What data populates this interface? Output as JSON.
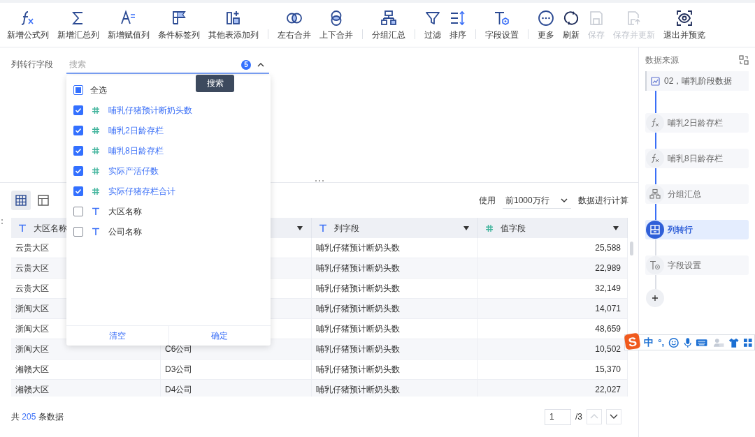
{
  "toolbar": {
    "groups": [
      [
        {
          "label": "新增公式列",
          "disabled": false
        },
        {
          "label": "新增汇总列",
          "disabled": false
        },
        {
          "label": "新增赋值列",
          "disabled": false
        },
        {
          "label": "条件标签列",
          "disabled": false
        },
        {
          "label": "其他表添加列",
          "disabled": false
        }
      ],
      [
        {
          "label": "左右合并",
          "disabled": false
        },
        {
          "label": "上下合并",
          "disabled": false
        }
      ],
      [
        {
          "label": "分组汇总",
          "disabled": false
        }
      ],
      [
        {
          "label": "过滤",
          "disabled": false
        },
        {
          "label": "排序",
          "disabled": false
        }
      ],
      [
        {
          "label": "字段设置",
          "disabled": false
        }
      ],
      [
        {
          "label": "更多",
          "disabled": false
        },
        {
          "label": "刷新",
          "disabled": false
        },
        {
          "label": "保存",
          "disabled": true
        },
        {
          "label": "保存并更新",
          "disabled": true
        },
        {
          "label": "退出并预览",
          "disabled": false
        }
      ]
    ]
  },
  "config": {
    "label": "列转行字段",
    "search": {
      "placeholder": "搜索",
      "count": "5",
      "expanded": true
    },
    "tooltip": "搜索",
    "dropdown": {
      "select_all": {
        "label": "全选",
        "checked": false,
        "indeterminate": true
      },
      "options": [
        {
          "label": "哺乳仔猪预计断奶头数",
          "kind": "number",
          "checked": true
        },
        {
          "label": "哺乳2日龄存栏",
          "kind": "number",
          "checked": true
        },
        {
          "label": "哺乳8日龄存栏",
          "kind": "number",
          "checked": true
        },
        {
          "label": "实际产活仔数",
          "kind": "number",
          "checked": true
        },
        {
          "label": "实际仔猪存栏合计",
          "kind": "number",
          "checked": true
        },
        {
          "label": "大区名称",
          "kind": "text",
          "checked": false
        },
        {
          "label": "公司名称",
          "kind": "text",
          "checked": false
        }
      ],
      "buttons": [
        "清空",
        "确定"
      ]
    }
  },
  "data_view": {
    "views": [
      {
        "selected": true
      },
      {
        "selected": false
      }
    ],
    "row_limit": {
      "prefix": "使用",
      "value": "前1000万行",
      "suffix": "数据进行计算"
    },
    "table": {
      "columns": [
        {
          "label": "大区名称",
          "kind": "text"
        },
        {
          "menu": true
        },
        {
          "label": "列字段",
          "kind": "text",
          "menu": true
        },
        {
          "label": "值字段",
          "kind": "number",
          "menu": true
        }
      ],
      "rows": [
        {
          "region": "云贵大区",
          "column_field": "哺乳仔猪预计断奶头数",
          "value": "25,588"
        },
        {
          "region": "云贵大区",
          "column_field": "哺乳仔猪预计断奶头数",
          "value": "22,989"
        },
        {
          "region": "云贵大区",
          "column_field": "哺乳仔猪预计断奶头数",
          "value": "32,149"
        },
        {
          "region": "浙闽大区",
          "column_field": "哺乳仔猪预计断奶头数",
          "value": "14,071"
        },
        {
          "region": "浙闽大区",
          "column_field": "哺乳仔猪预计断奶头数",
          "value": "48,659"
        },
        {
          "region": "浙闽大区",
          "company": "C6公司",
          "column_field": "哺乳仔猪预计断奶头数",
          "value": "10,502"
        },
        {
          "region": "湘赣大区",
          "company": "D3公司",
          "column_field": "哺乳仔猪预计断奶头数",
          "value": "15,370"
        },
        {
          "region": "湘赣大区",
          "company": "D4公司",
          "column_field": "哺乳仔猪预计断奶头数",
          "value": "22,027"
        }
      ]
    },
    "footer": {
      "total": "共 **205** 条数据",
      "pager": {
        "page": "1",
        "pages": "/3",
        "prev": {
          "disabled": true
        },
        "next": {
          "disabled": false
        }
      }
    }
  },
  "sidebar": {
    "title": "数据来源",
    "source": "02，哺乳阶段数据",
    "steps": [
      {
        "kind": "formula",
        "label": "哺乳2日龄存栏",
        "selected": false
      },
      {
        "kind": "formula",
        "label": "哺乳8日龄存栏",
        "selected": false
      },
      {
        "kind": "group",
        "label": "分组汇总",
        "selected": false
      },
      {
        "kind": "pivot",
        "label": "列转行",
        "selected": true
      },
      {
        "kind": "fields",
        "label": "字段设置",
        "selected": false
      }
    ]
  },
  "ime": {
    "logo": "S",
    "mode": "中",
    "punct": "°,"
  }
}
